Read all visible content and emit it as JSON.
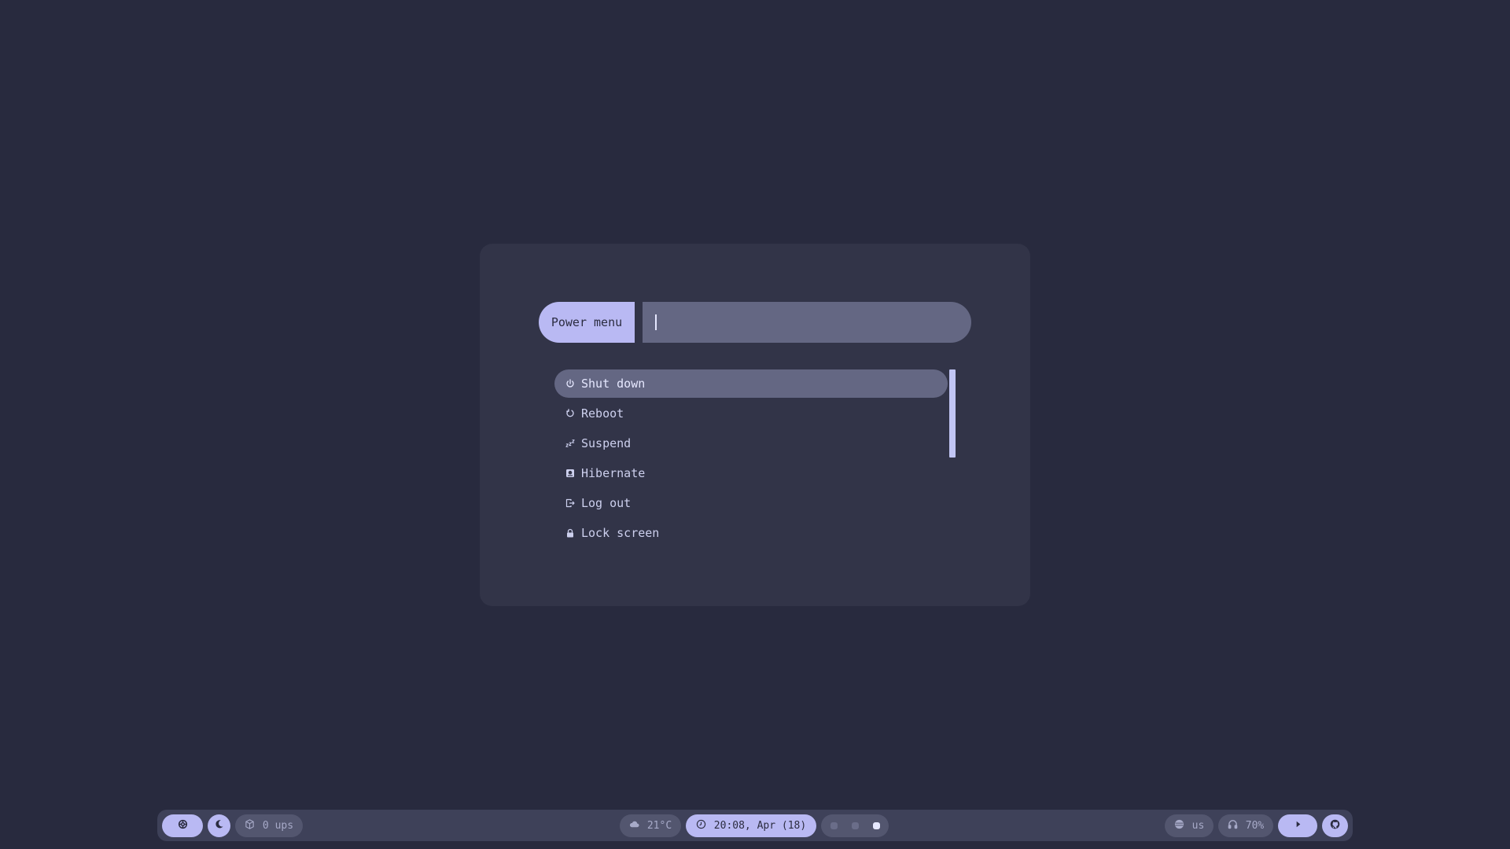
{
  "launcher": {
    "prompt_label": "Power menu",
    "search": {
      "value": "",
      "placeholder": ""
    },
    "items": [
      {
        "label": "Shut down",
        "icon": "power-icon",
        "selected": true
      },
      {
        "label": "Reboot",
        "icon": "reboot-icon",
        "selected": false
      },
      {
        "label": "Suspend",
        "icon": "sleep-icon",
        "selected": false
      },
      {
        "label": "Hibernate",
        "icon": "hibernate-icon",
        "selected": false
      },
      {
        "label": "Log out",
        "icon": "logout-icon",
        "selected": false
      },
      {
        "label": "Lock screen",
        "icon": "lock-icon",
        "selected": false
      }
    ]
  },
  "bar": {
    "launcher_icon": "settings-ring-icon",
    "theme_icon": "moon-icon",
    "updates": {
      "icon": "package-icon",
      "label": "0 ups"
    },
    "weather": {
      "icon": "cloud-icon",
      "label": "21°C"
    },
    "clock": {
      "icon": "clock-icon",
      "label": "20:08, Apr (18)"
    },
    "workspaces": {
      "count": 3,
      "active_index": 2
    },
    "keyboard": {
      "icon": "globe-icon",
      "label": "us"
    },
    "volume": {
      "icon": "headphones-icon",
      "label": "70%"
    },
    "media_icon": "play-icon",
    "github_icon": "github-icon"
  },
  "colors": {
    "background": "#282a3e",
    "window": "#323448",
    "accent": "#b9b9f3",
    "highlight": "#646783"
  }
}
